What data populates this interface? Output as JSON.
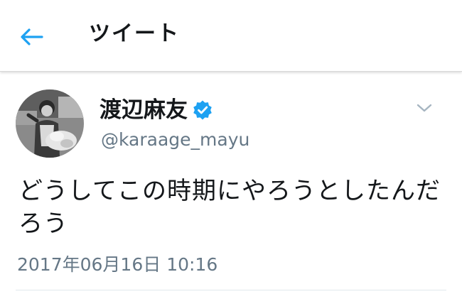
{
  "header": {
    "title": "ツイート",
    "back_icon": "back-arrow-icon",
    "accent_color": "#1da1f2"
  },
  "tweet": {
    "avatar_icon": "avatar",
    "display_name": "渡辺麻友",
    "verified_icon": "verified-badge-icon",
    "handle": "@karaage_mayu",
    "menu_icon": "chevron-down-icon",
    "text": "どうしてこの時期にやろうとしたんだろう",
    "timestamp": "2017年06月16日 10:16"
  }
}
